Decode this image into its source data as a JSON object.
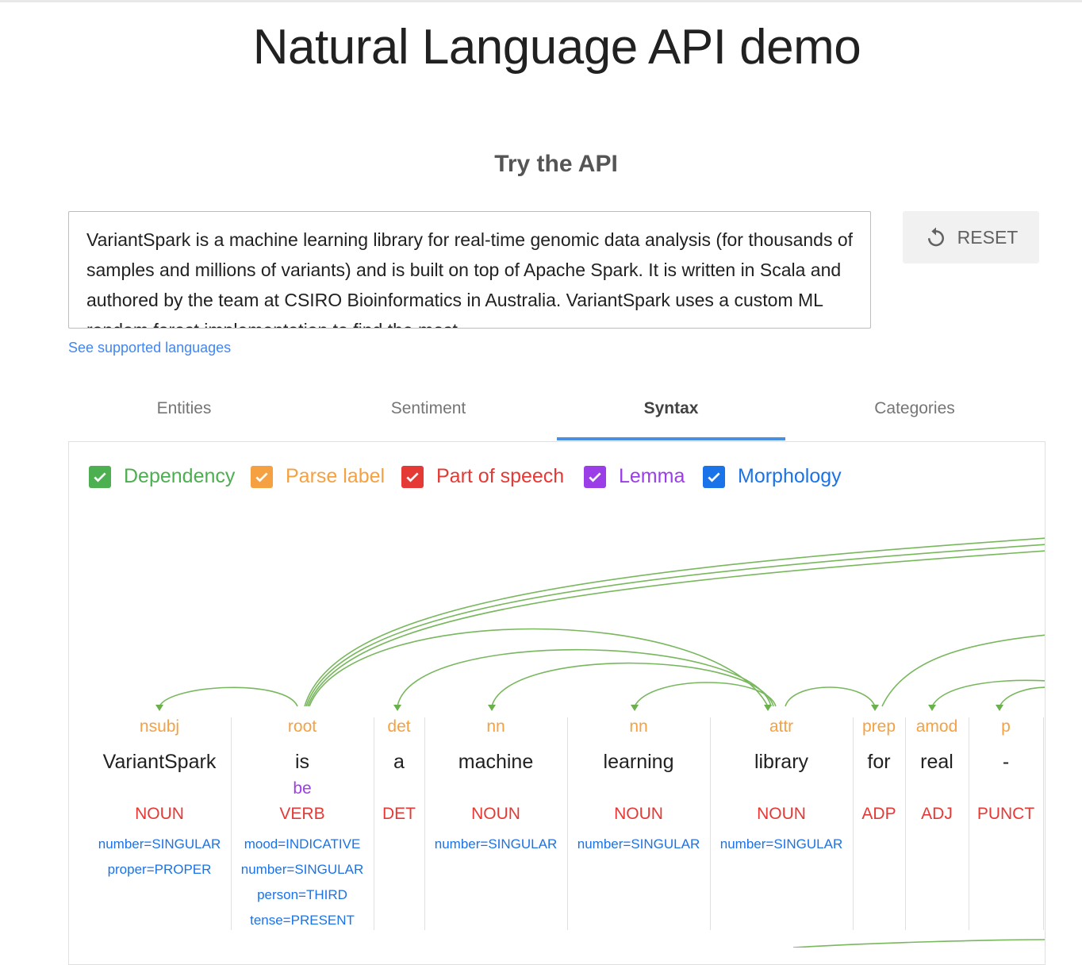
{
  "page": {
    "title": "Natural Language API demo",
    "subtitle": "Try the API",
    "input_text": "VariantSpark is a machine learning library for real-time genomic data analysis (for thousands of samples and millions of variants) and is built on top of Apache Spark. It is written in Scala and authored by the team at CSIRO Bioinformatics in Australia. VariantSpark uses a custom ML random forest implementation to find the most",
    "reset_label": "RESET",
    "supported_languages_link": "See supported languages"
  },
  "tabs": [
    {
      "label": "Entities"
    },
    {
      "label": "Sentiment"
    },
    {
      "label": "Syntax",
      "active": true
    },
    {
      "label": "Categories"
    }
  ],
  "options": [
    {
      "label": "Dependency",
      "color": "#4caf50",
      "checked": true
    },
    {
      "label": "Parse label",
      "color": "#f5a142",
      "checked": true
    },
    {
      "label": "Part of speech",
      "color": "#e53935",
      "checked": true
    },
    {
      "label": "Lemma",
      "color": "#9c3ee8",
      "checked": true
    },
    {
      "label": "Morphology",
      "color": "#1a73e8",
      "checked": true
    }
  ],
  "tokens": [
    {
      "label": "nsubj",
      "word": "VariantSpark",
      "lemma": "",
      "pos": "NOUN",
      "morph": [
        "number=SINGULAR",
        "proper=PROPER"
      ]
    },
    {
      "label": "root",
      "word": "is",
      "lemma": "be",
      "pos": "VERB",
      "morph": [
        "mood=INDICATIVE",
        "number=SINGULAR",
        "person=THIRD",
        "tense=PRESENT"
      ]
    },
    {
      "label": "det",
      "word": "a",
      "lemma": "",
      "pos": "DET",
      "morph": []
    },
    {
      "label": "nn",
      "word": "machine",
      "lemma": "",
      "pos": "NOUN",
      "morph": [
        "number=SINGULAR"
      ]
    },
    {
      "label": "nn",
      "word": "learning",
      "lemma": "",
      "pos": "NOUN",
      "morph": [
        "number=SINGULAR"
      ]
    },
    {
      "label": "attr",
      "word": "library",
      "lemma": "",
      "pos": "NOUN",
      "morph": [
        "number=SINGULAR"
      ]
    },
    {
      "label": "prep",
      "word": "for",
      "lemma": "",
      "pos": "ADP",
      "morph": []
    },
    {
      "label": "amod",
      "word": "real",
      "lemma": "",
      "pos": "ADJ",
      "morph": []
    },
    {
      "label": "p",
      "word": "-",
      "lemma": "",
      "pos": "PUNCT",
      "morph": []
    }
  ]
}
